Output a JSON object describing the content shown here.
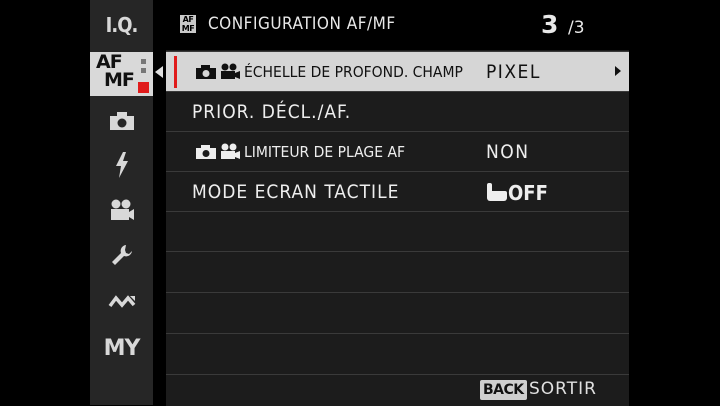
{
  "sidebar": {
    "items": [
      {
        "label": "I.Q."
      },
      {
        "label": "AF MF",
        "line1": "AF",
        "line2": "MF",
        "selected": true
      },
      {
        "icon": "camera-icon"
      },
      {
        "icon": "flash-icon"
      },
      {
        "icon": "movie-camera-icon"
      },
      {
        "icon": "wrench-icon"
      },
      {
        "icon": "connection-icon"
      },
      {
        "label": "MY"
      }
    ]
  },
  "header": {
    "logo_line1": "AF",
    "logo_line2": "MF",
    "title": "CONFIGURATION AF/MF",
    "page": "3",
    "page_total": "/3"
  },
  "menu": {
    "rows": [
      {
        "label": "ÉCHELLE DE PROFOND. CHAMP",
        "value": "PIXEL",
        "icons": [
          "camera-icon",
          "movie-camera-icon"
        ],
        "selected": true
      },
      {
        "label": "PRIOR. DÉCL./AF.",
        "value": ""
      },
      {
        "label": "LIMITEUR DE PLAGE AF",
        "value": "NON",
        "icons": [
          "camera-icon",
          "movie-camera-icon"
        ]
      },
      {
        "label": "MODE ECRAN TACTILE",
        "value": "OFF",
        "value_icon": "touch-hand-icon"
      }
    ]
  },
  "footer": {
    "back_key": "BACK",
    "back_label": "SORTIR"
  },
  "colors": {
    "accent_red": "#e01b1b",
    "selected_bg": "#d6d6d6",
    "panel_bg": "#1c1c1c",
    "sidebar_bg": "#262626"
  }
}
